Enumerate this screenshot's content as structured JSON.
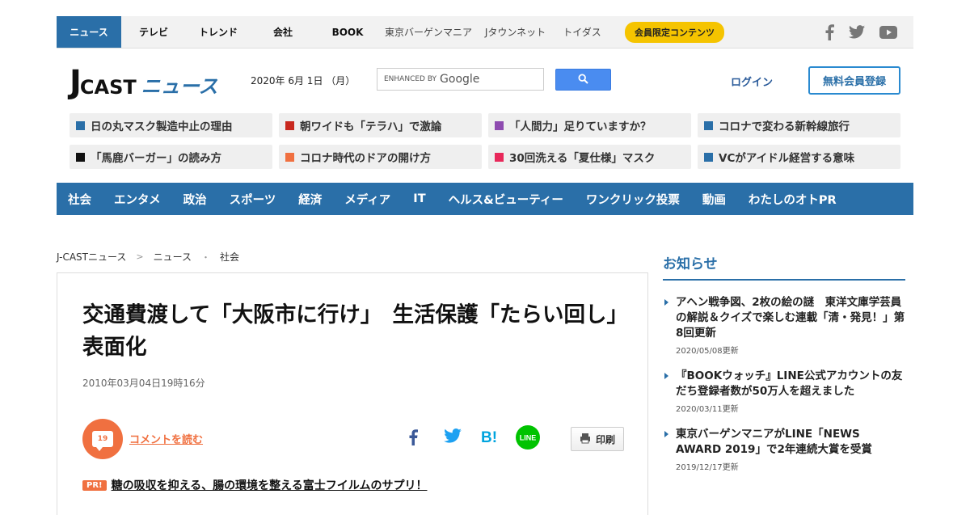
{
  "topbar": {
    "nav": [
      {
        "label": "ニュース",
        "active": true,
        "light": false,
        "width": 80
      },
      {
        "label": "テレビ",
        "active": false,
        "light": false,
        "width": 80
      },
      {
        "label": "トレンド",
        "active": false,
        "light": false,
        "width": 80
      },
      {
        "label": "会社",
        "active": false,
        "light": false,
        "width": 80
      },
      {
        "label": "BOOK",
        "active": false,
        "light": false,
        "width": 80
      },
      {
        "label": "東京バーゲンマニア",
        "active": false,
        "light": true,
        "width": 120
      },
      {
        "label": "Jタウンネット",
        "active": false,
        "light": true,
        "width": 95
      },
      {
        "label": "トイダス",
        "active": false,
        "light": true,
        "width": 70
      }
    ],
    "member_badge": "会員限定コンテンツ"
  },
  "header": {
    "logo": {
      "j": "J",
      "cast": "CAST",
      "news": "ニュース"
    },
    "date": "2020年 6月 1日 （月）",
    "search": {
      "enhanced_by": "ENHANCED BY",
      "google": "Google"
    },
    "login": "ログイン",
    "register": "無料会員登録"
  },
  "topics": [
    {
      "label": "日の丸マスク製造中止の理由",
      "color": "#2a6fa8"
    },
    {
      "label": "朝ワイドも「テラハ」で激論",
      "color": "#c8281e"
    },
    {
      "label": "「人間力」足りていますか？",
      "color": "#8e4bb0"
    },
    {
      "label": "コロナで変わる新幹線旅行",
      "color": "#2a6fa8"
    },
    {
      "label": "「馬鹿バーガー」の読み方",
      "color": "#111111"
    },
    {
      "label": "コロナ時代のドアの開け方",
      "color": "#f07040"
    },
    {
      "label": "30回洗える「夏仕様」マスク",
      "color": "#e8285a"
    },
    {
      "label": "VCがアイドル経営する意味",
      "color": "#2a6fa8"
    }
  ],
  "categories": [
    "社会",
    "エンタメ",
    "政治",
    "スポーツ",
    "経済",
    "メディア",
    "IT",
    "ヘルス&ビューティー",
    "ワンクリック投票",
    "動画",
    "わたしのオトPR"
  ],
  "breadcrumb": {
    "home": "J-CASTニュース",
    "section": "ニュース",
    "current": "社会"
  },
  "article": {
    "headline": "交通費渡して「大阪市に行け」　生活保護「たらい回し」表面化",
    "published": "2010年03月04日19時16分",
    "comment_count": "19",
    "comment_link": "コメントを読む",
    "print": "印刷",
    "pr_badge": "PR!",
    "pr_link": "糖の吸収を抑える、腸の環境を整える富士フイルムのサプリ！"
  },
  "sidebar": {
    "title": "お知らせ",
    "items": [
      {
        "text": "アヘン戦争図、2枚の絵の謎　東洋文庫学芸員の解説＆クイズで楽しむ連載「清・発見！」第8回更新",
        "date": "2020/05/08更新"
      },
      {
        "text": "『BOOKウォッチ』LINE公式アカウントの友だち登録者数が50万人を超えました",
        "date": "2020/03/11更新"
      },
      {
        "text": "東京バーゲンマニアがLINE「NEWS AWARD 2019」で2年連続大賞を受賞",
        "date": "2019/12/17更新"
      }
    ]
  },
  "colors": {
    "brand": "#2a6fa8",
    "accent": "#f07040",
    "badge": "#f5c400"
  }
}
